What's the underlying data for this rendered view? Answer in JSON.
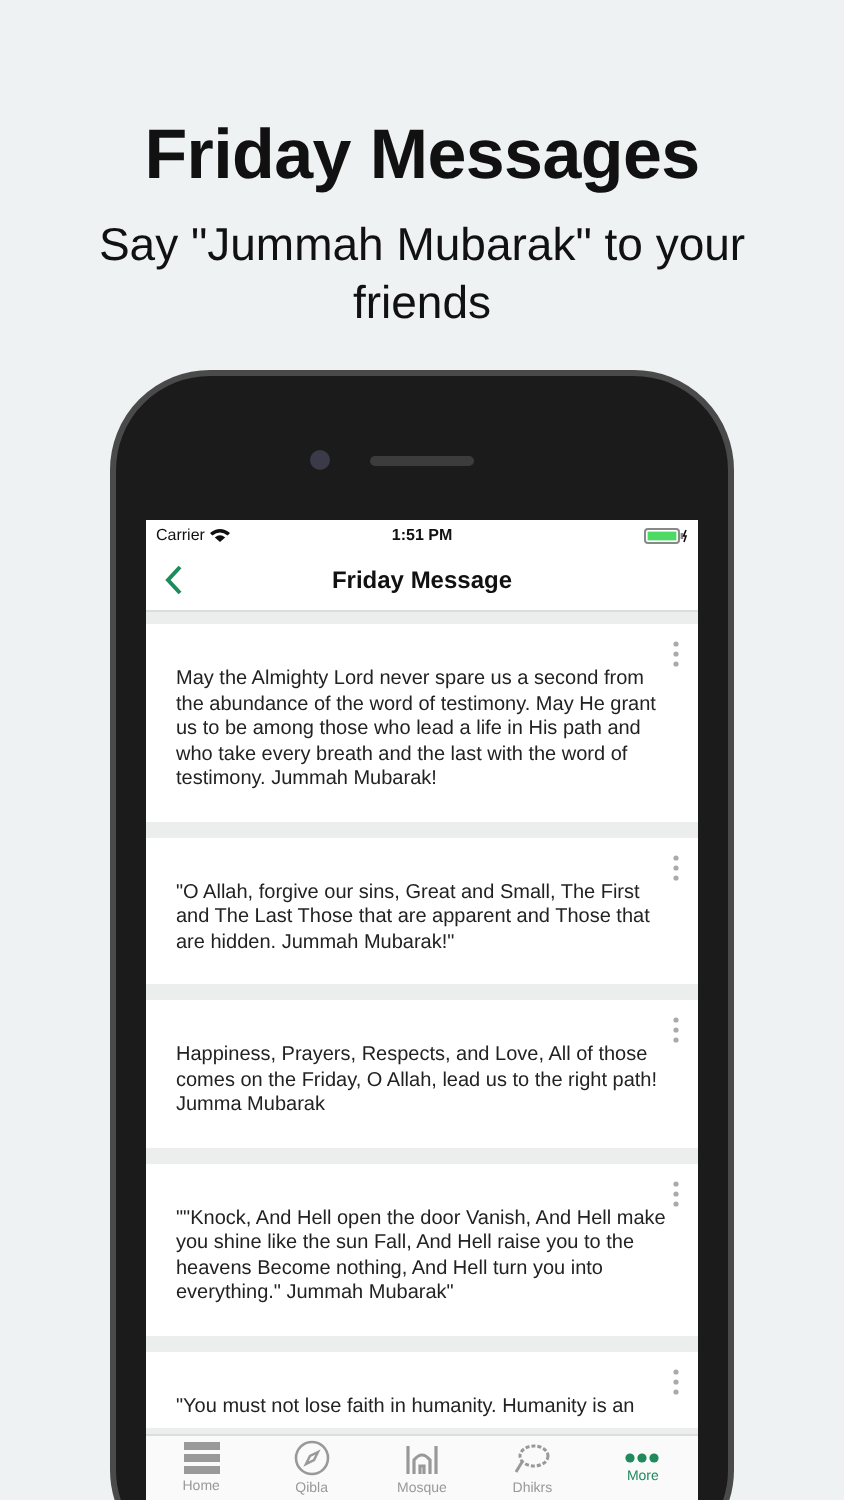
{
  "headline": "Friday Messages",
  "subheadline": "Say \"Jummah Mubarak\" to your friends",
  "status_bar": {
    "carrier": "Carrier",
    "time": "1:51 PM"
  },
  "nav_bar": {
    "title": "Friday Message"
  },
  "messages": [
    {
      "text": "May the Almighty Lord never spare us a second from the abundance of the word of testimony. May He grant us to be among those who lead a life in His path and who take every breath and the last with the word of testimony. Jummah Mubarak!"
    },
    {
      "text": "\"O Allah, forgive our sins, Great and Small, The First and The Last Those that are apparent and Those that are hidden. Jummah Mubarak!\""
    },
    {
      "text": "Happiness, Prayers, Respects, and Love, All of those comes on the Friday, O Allah, lead us to the right path! Jumma Mubarak"
    },
    {
      "text": "\"\"Knock, And Hell open the door Vanish, And Hell make you shine like the sun Fall, And Hell raise you to the heavens Become nothing, And Hell turn you into everything.\" Jummah Mubarak\""
    },
    {
      "text": "\"You must not lose faith in humanity. Humanity is an"
    }
  ],
  "tab_bar": [
    {
      "label": "Home",
      "kind": "home",
      "selected": false
    },
    {
      "label": "Qibla",
      "kind": "qibla",
      "selected": false
    },
    {
      "label": "Mosque",
      "kind": "mosque",
      "selected": false
    },
    {
      "label": "Dhikrs",
      "kind": "dhikrs",
      "selected": false
    },
    {
      "label": "More",
      "kind": "more",
      "selected": true
    }
  ]
}
